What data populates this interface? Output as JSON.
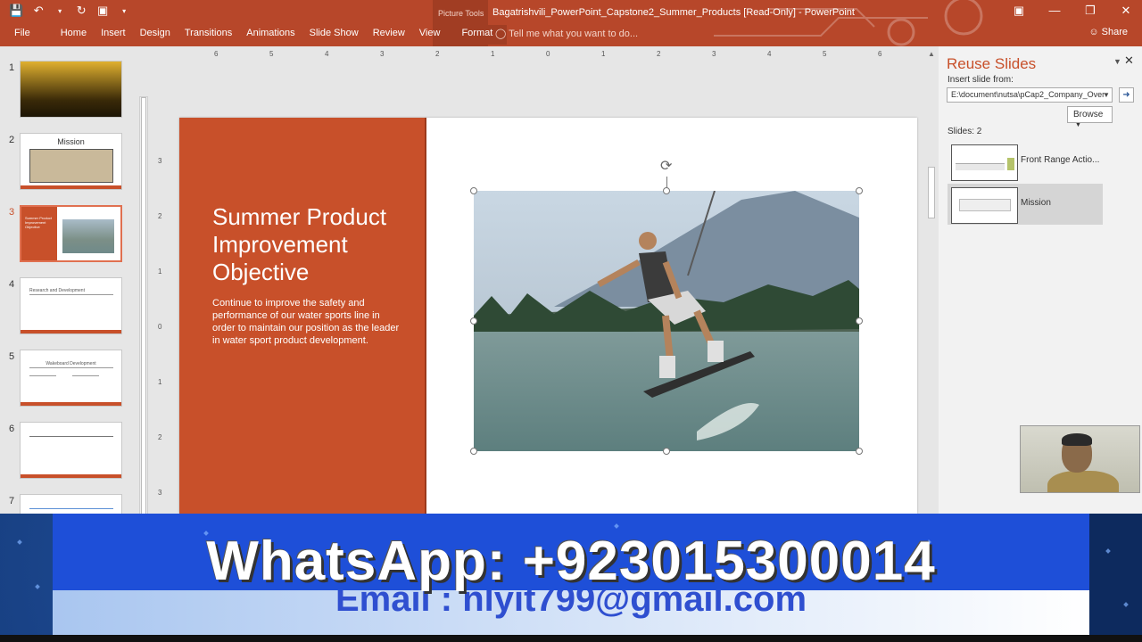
{
  "titlebar": {
    "context_tab": "Picture Tools",
    "doc_title": "Bagatrishvili_PowerPoint_Capstone2_Summer_Products [Read-Only] - PowerPoint",
    "tell_me": "Tell me what you want to do...",
    "share": "Share",
    "colors": {
      "accent": "#b7472a",
      "context": "#a13d23"
    }
  },
  "ribbon_tabs": [
    "File",
    "Home",
    "Insert",
    "Design",
    "Transitions",
    "Animations",
    "Slide Show",
    "Review",
    "View",
    "Format"
  ],
  "thumbnails": {
    "numbers": [
      "1",
      "2",
      "3",
      "4",
      "5",
      "6",
      "7"
    ],
    "slide2_title": "Mission",
    "slide3_title": "Summer Product Improvement Objective",
    "slide4_title": "Research and Development",
    "slide5_title": "Wakeboard Development"
  },
  "rulers": {
    "h_ticks": [
      "6",
      "5",
      "4",
      "3",
      "2",
      "1",
      "0",
      "1",
      "2",
      "3",
      "4",
      "5",
      "6"
    ],
    "v_ticks": [
      "3",
      "2",
      "1",
      "0",
      "1",
      "2",
      "3"
    ]
  },
  "slide": {
    "title": "Summer Product Improvement Objective",
    "body": "Continue to improve the safety and performance of our water sports line in order to maintain our position as the leader in water sport product development.",
    "accent": "#c8502a"
  },
  "reuse_pane": {
    "title": "Reuse Slides",
    "insert_label": "Insert slide from:",
    "path_value": "E:\\document\\nutsa\\pCap2_Company_Over",
    "browse": "Browse",
    "slides_count": "Slides: 2",
    "items": [
      {
        "label": "Front Range Actio..."
      },
      {
        "label": "Mission"
      }
    ]
  },
  "banner": {
    "whatsapp": "WhatsApp: +923015300014",
    "email": "Email : nlyit799@gmail.com"
  }
}
